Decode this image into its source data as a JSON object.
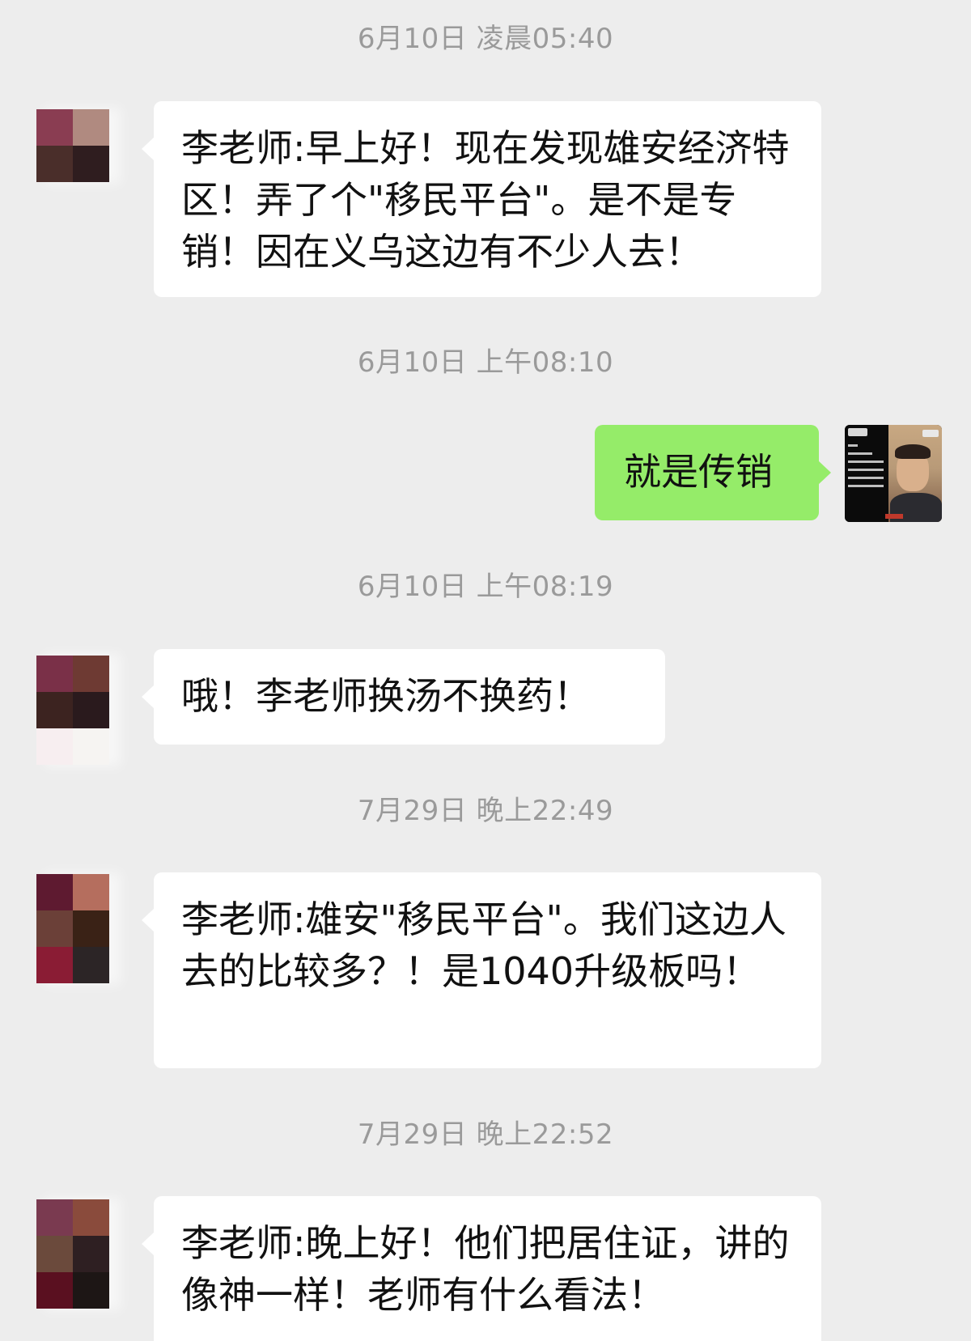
{
  "chat": {
    "messages": [
      {
        "timestamp": "6月10日 凌晨05:40",
        "sender": "contact",
        "text": "李老师:早上好！现在发现雄安经济特区！弄了个\"移民平台\"。是不是专销！因在义乌这边有不少人去！"
      },
      {
        "timestamp": "6月10日 上午08:10",
        "sender": "self",
        "text": "就是传销"
      },
      {
        "timestamp": "6月10日 上午08:19",
        "sender": "contact",
        "text": "哦！李老师换汤不换药！"
      },
      {
        "timestamp": "7月29日 晚上22:49",
        "sender": "contact",
        "text": "李老师:雄安\"移民平台\"。我们这边人去的比较多？！是1040升级板吗！"
      },
      {
        "timestamp": "7月29日 晚上22:52",
        "sender": "contact",
        "text": "李老师:晚上好！他们把居住证，讲的像神一样！老师有什么看法！"
      }
    ]
  },
  "colors": {
    "background": "#ededed",
    "incoming_bubble": "#ffffff",
    "outgoing_bubble": "#95ec69",
    "timestamp_text": "#9a9a9a"
  },
  "icons": {
    "contact_avatar": "pixelated-avatar-icon",
    "self_avatar": "news-broadcast-photo-avatar"
  }
}
